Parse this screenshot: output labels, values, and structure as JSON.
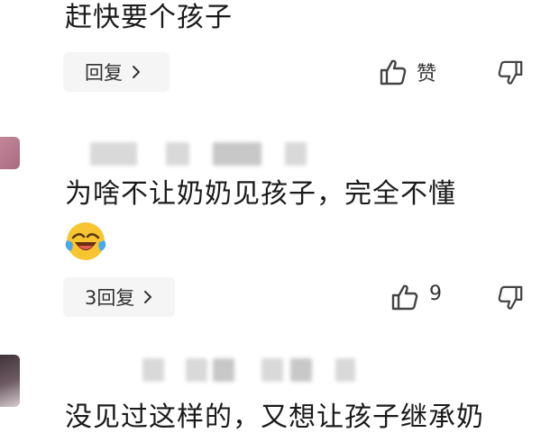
{
  "comments": [
    {
      "text": "赶快要个孩子",
      "reply_label": "回复",
      "like_label": "赞"
    },
    {
      "text": "为啥不让奶奶见孩子，完全不懂",
      "emoji": "laughing-crying-emoji",
      "reply_label": "3回复",
      "like_count": "9"
    },
    {
      "text": "没见过这样的，又想让孩子继承奶"
    }
  ],
  "icons": {
    "like": "thumbs-up-icon",
    "dislike": "thumbs-down-icon",
    "chevron": "chevron-right-icon"
  },
  "colors": {
    "background": "#ffffff",
    "text": "#1a1a1a",
    "pill_background": "#f5f5f5",
    "icon": "#444444",
    "emoji_yellow": "#f7c531"
  }
}
